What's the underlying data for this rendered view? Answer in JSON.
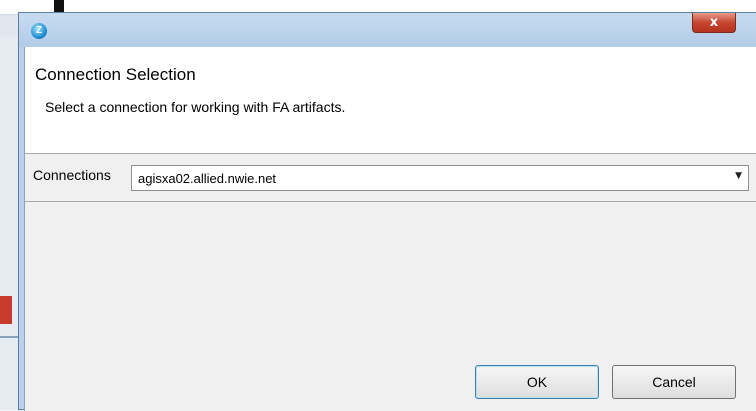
{
  "dialog": {
    "icon": "app-logo-icon",
    "close_label": "x",
    "header_title": "Connection Selection",
    "header_description": "Select a connection for working with FA artifacts.",
    "connections_label": "Connections",
    "connection_selected": "agisxa02.allied.nwie.net",
    "ok_label": "OK",
    "cancel_label": "Cancel"
  },
  "colors": {
    "titlebar": "#b9d1ea",
    "close_button": "#c6452f",
    "client_background": "#f0f0f0"
  }
}
